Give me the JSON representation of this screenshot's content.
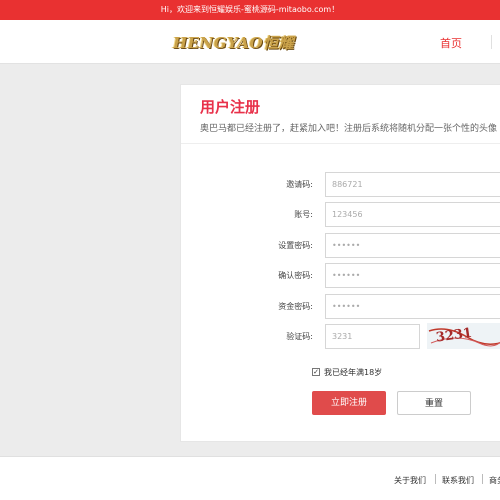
{
  "topbar": {
    "text": "Hi，欢迎来到恒耀娱乐-蜜桃源码-mitaobo.com！"
  },
  "header": {
    "logo_text": "HENGYAO恒耀",
    "nav_home": "首页"
  },
  "register": {
    "title": "用户注册",
    "subtitle": "奥巴马都已经注册了，赶紧加入吧！注册后系统将随机分配一张个性的头像",
    "fields": [
      {
        "label": "邀请码:",
        "value": "886721"
      },
      {
        "label": "账号:",
        "value": "123456"
      },
      {
        "label": "设置密码:",
        "value": "••••••"
      },
      {
        "label": "确认密码:",
        "value": "••••••"
      },
      {
        "label": "资金密码:",
        "value": "••••••"
      },
      {
        "label": "验证码:",
        "value": "3231"
      }
    ],
    "captcha_text": "3231",
    "age_check": {
      "checked": true,
      "label": "我已经年满18岁"
    },
    "submit_label": "立即注册",
    "reset_label": "重置"
  },
  "footer": {
    "links": [
      "关于我们",
      "联系我们",
      "商务合作"
    ]
  }
}
